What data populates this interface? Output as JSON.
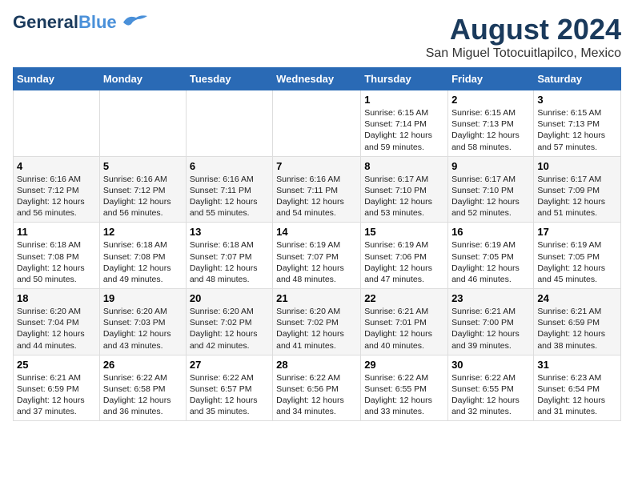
{
  "header": {
    "logo_general": "General",
    "logo_blue": "Blue",
    "month_year": "August 2024",
    "location": "San Miguel Totocuitlapilco, Mexico"
  },
  "weekdays": [
    "Sunday",
    "Monday",
    "Tuesday",
    "Wednesday",
    "Thursday",
    "Friday",
    "Saturday"
  ],
  "weeks": [
    [
      {
        "day": "",
        "content": ""
      },
      {
        "day": "",
        "content": ""
      },
      {
        "day": "",
        "content": ""
      },
      {
        "day": "",
        "content": ""
      },
      {
        "day": "1",
        "content": "Sunrise: 6:15 AM\nSunset: 7:14 PM\nDaylight: 12 hours\nand 59 minutes."
      },
      {
        "day": "2",
        "content": "Sunrise: 6:15 AM\nSunset: 7:13 PM\nDaylight: 12 hours\nand 58 minutes."
      },
      {
        "day": "3",
        "content": "Sunrise: 6:15 AM\nSunset: 7:13 PM\nDaylight: 12 hours\nand 57 minutes."
      }
    ],
    [
      {
        "day": "4",
        "content": "Sunrise: 6:16 AM\nSunset: 7:12 PM\nDaylight: 12 hours\nand 56 minutes."
      },
      {
        "day": "5",
        "content": "Sunrise: 6:16 AM\nSunset: 7:12 PM\nDaylight: 12 hours\nand 56 minutes."
      },
      {
        "day": "6",
        "content": "Sunrise: 6:16 AM\nSunset: 7:11 PM\nDaylight: 12 hours\nand 55 minutes."
      },
      {
        "day": "7",
        "content": "Sunrise: 6:16 AM\nSunset: 7:11 PM\nDaylight: 12 hours\nand 54 minutes."
      },
      {
        "day": "8",
        "content": "Sunrise: 6:17 AM\nSunset: 7:10 PM\nDaylight: 12 hours\nand 53 minutes."
      },
      {
        "day": "9",
        "content": "Sunrise: 6:17 AM\nSunset: 7:10 PM\nDaylight: 12 hours\nand 52 minutes."
      },
      {
        "day": "10",
        "content": "Sunrise: 6:17 AM\nSunset: 7:09 PM\nDaylight: 12 hours\nand 51 minutes."
      }
    ],
    [
      {
        "day": "11",
        "content": "Sunrise: 6:18 AM\nSunset: 7:08 PM\nDaylight: 12 hours\nand 50 minutes."
      },
      {
        "day": "12",
        "content": "Sunrise: 6:18 AM\nSunset: 7:08 PM\nDaylight: 12 hours\nand 49 minutes."
      },
      {
        "day": "13",
        "content": "Sunrise: 6:18 AM\nSunset: 7:07 PM\nDaylight: 12 hours\nand 48 minutes."
      },
      {
        "day": "14",
        "content": "Sunrise: 6:19 AM\nSunset: 7:07 PM\nDaylight: 12 hours\nand 48 minutes."
      },
      {
        "day": "15",
        "content": "Sunrise: 6:19 AM\nSunset: 7:06 PM\nDaylight: 12 hours\nand 47 minutes."
      },
      {
        "day": "16",
        "content": "Sunrise: 6:19 AM\nSunset: 7:05 PM\nDaylight: 12 hours\nand 46 minutes."
      },
      {
        "day": "17",
        "content": "Sunrise: 6:19 AM\nSunset: 7:05 PM\nDaylight: 12 hours\nand 45 minutes."
      }
    ],
    [
      {
        "day": "18",
        "content": "Sunrise: 6:20 AM\nSunset: 7:04 PM\nDaylight: 12 hours\nand 44 minutes."
      },
      {
        "day": "19",
        "content": "Sunrise: 6:20 AM\nSunset: 7:03 PM\nDaylight: 12 hours\nand 43 minutes."
      },
      {
        "day": "20",
        "content": "Sunrise: 6:20 AM\nSunset: 7:02 PM\nDaylight: 12 hours\nand 42 minutes."
      },
      {
        "day": "21",
        "content": "Sunrise: 6:20 AM\nSunset: 7:02 PM\nDaylight: 12 hours\nand 41 minutes."
      },
      {
        "day": "22",
        "content": "Sunrise: 6:21 AM\nSunset: 7:01 PM\nDaylight: 12 hours\nand 40 minutes."
      },
      {
        "day": "23",
        "content": "Sunrise: 6:21 AM\nSunset: 7:00 PM\nDaylight: 12 hours\nand 39 minutes."
      },
      {
        "day": "24",
        "content": "Sunrise: 6:21 AM\nSunset: 6:59 PM\nDaylight: 12 hours\nand 38 minutes."
      }
    ],
    [
      {
        "day": "25",
        "content": "Sunrise: 6:21 AM\nSunset: 6:59 PM\nDaylight: 12 hours\nand 37 minutes."
      },
      {
        "day": "26",
        "content": "Sunrise: 6:22 AM\nSunset: 6:58 PM\nDaylight: 12 hours\nand 36 minutes."
      },
      {
        "day": "27",
        "content": "Sunrise: 6:22 AM\nSunset: 6:57 PM\nDaylight: 12 hours\nand 35 minutes."
      },
      {
        "day": "28",
        "content": "Sunrise: 6:22 AM\nSunset: 6:56 PM\nDaylight: 12 hours\nand 34 minutes."
      },
      {
        "day": "29",
        "content": "Sunrise: 6:22 AM\nSunset: 6:55 PM\nDaylight: 12 hours\nand 33 minutes."
      },
      {
        "day": "30",
        "content": "Sunrise: 6:22 AM\nSunset: 6:55 PM\nDaylight: 12 hours\nand 32 minutes."
      },
      {
        "day": "31",
        "content": "Sunrise: 6:23 AM\nSunset: 6:54 PM\nDaylight: 12 hours\nand 31 minutes."
      }
    ]
  ]
}
